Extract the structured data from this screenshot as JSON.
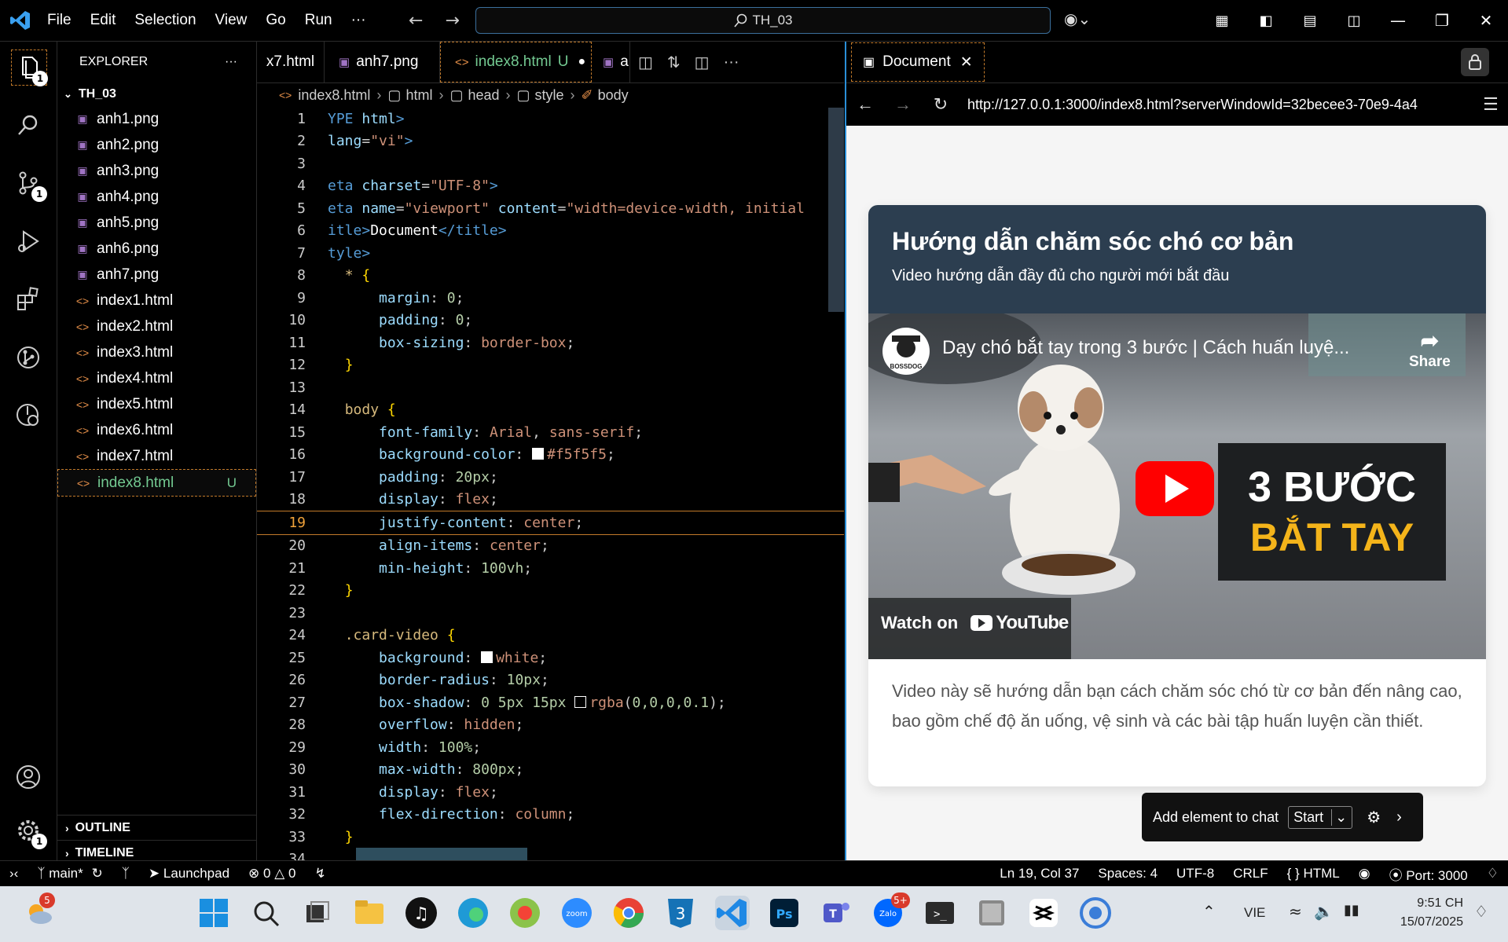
{
  "titlebar": {
    "menus": [
      "File",
      "Edit",
      "Selection",
      "View",
      "Go",
      "Run",
      "···"
    ],
    "search": "TH_03"
  },
  "activity": {
    "explorer_badge": "1",
    "scm_badge": "1",
    "settings_badge": "1"
  },
  "explorer": {
    "header": "EXPLORER",
    "folder": "TH_03",
    "files": [
      {
        "name": "anh1.png",
        "type": "png"
      },
      {
        "name": "anh2.png",
        "type": "png"
      },
      {
        "name": "anh3.png",
        "type": "png"
      },
      {
        "name": "anh4.png",
        "type": "png"
      },
      {
        "name": "anh5.png",
        "type": "png"
      },
      {
        "name": "anh6.png",
        "type": "png"
      },
      {
        "name": "anh7.png",
        "type": "png"
      },
      {
        "name": "index1.html",
        "type": "html"
      },
      {
        "name": "index2.html",
        "type": "html"
      },
      {
        "name": "index3.html",
        "type": "html"
      },
      {
        "name": "index4.html",
        "type": "html"
      },
      {
        "name": "index5.html",
        "type": "html"
      },
      {
        "name": "index6.html",
        "type": "html"
      },
      {
        "name": "index7.html",
        "type": "html"
      },
      {
        "name": "index8.html",
        "type": "html",
        "status": "U",
        "active": true
      }
    ],
    "outline": "OUTLINE",
    "timeline": "TIMELINE"
  },
  "editor": {
    "tabs": [
      {
        "label": "x7.html",
        "icon": ""
      },
      {
        "label": "anh7.png",
        "icon": "png"
      },
      {
        "label": "index8.html",
        "icon": "html",
        "status": "U",
        "active": true
      },
      {
        "label": "anh",
        "icon": "png"
      }
    ],
    "breadcrumb": [
      "index8.html",
      "html",
      "head",
      "style",
      "body"
    ],
    "current_line": 19,
    "lines": [
      [
        [
          "tk-tag",
          "YPE "
        ],
        [
          "tk-attr",
          "html"
        ],
        [
          "tk-tag",
          ">"
        ]
      ],
      [
        [
          "tk-attr",
          "lang"
        ],
        [
          "tk-p",
          "="
        ],
        [
          "tk-str",
          "\"vi\""
        ],
        [
          "tk-tag",
          ">"
        ]
      ],
      [],
      [
        [
          "tk-tag",
          "eta "
        ],
        [
          "tk-attr",
          "charset"
        ],
        [
          "tk-p",
          "="
        ],
        [
          "tk-str",
          "\"UTF-8\""
        ],
        [
          "tk-tag",
          ">"
        ]
      ],
      [
        [
          "tk-tag",
          "eta "
        ],
        [
          "tk-attr",
          "name"
        ],
        [
          "tk-p",
          "="
        ],
        [
          "tk-str",
          "\"viewport\" "
        ],
        [
          "tk-attr",
          "content"
        ],
        [
          "tk-p",
          "="
        ],
        [
          "tk-str",
          "\"width=device-width, initial"
        ]
      ],
      [
        [
          "tk-tag",
          "itle>"
        ],
        [
          "tk-txt",
          "Document"
        ],
        [
          "tk-tag",
          "</title>"
        ]
      ],
      [
        [
          "tk-tag",
          "tyle>"
        ]
      ],
      [
        [
          "tk-p",
          "  "
        ],
        [
          "tk-sel",
          "* "
        ],
        [
          "tk-br",
          "{"
        ]
      ],
      [
        [
          "tk-p",
          "      "
        ],
        [
          "tk-prop",
          "margin"
        ],
        [
          "tk-p",
          ": "
        ],
        [
          "tk-num",
          "0"
        ],
        [
          "tk-p",
          ";"
        ]
      ],
      [
        [
          "tk-p",
          "      "
        ],
        [
          "tk-prop",
          "padding"
        ],
        [
          "tk-p",
          ": "
        ],
        [
          "tk-num",
          "0"
        ],
        [
          "tk-p",
          ";"
        ]
      ],
      [
        [
          "tk-p",
          "      "
        ],
        [
          "tk-prop",
          "box-sizing"
        ],
        [
          "tk-p",
          ": "
        ],
        [
          "tk-val",
          "border-box"
        ],
        [
          "tk-p",
          ";"
        ]
      ],
      [
        [
          "tk-p",
          "  "
        ],
        [
          "tk-br",
          "}"
        ]
      ],
      [],
      [
        [
          "tk-p",
          "  "
        ],
        [
          "tk-sel",
          "body "
        ],
        [
          "tk-br",
          "{"
        ]
      ],
      [
        [
          "tk-p",
          "      "
        ],
        [
          "tk-prop",
          "font-family"
        ],
        [
          "tk-p",
          ": "
        ],
        [
          "tk-val",
          "Arial"
        ],
        [
          "tk-p",
          ", "
        ],
        [
          "tk-val",
          "sans-serif"
        ],
        [
          "tk-p",
          ";"
        ]
      ],
      [
        [
          "tk-p",
          "      "
        ],
        [
          "tk-prop",
          "background-color"
        ],
        [
          "tk-p",
          ": "
        ],
        [
          "swatch",
          "#ffffff"
        ],
        [
          "tk-val",
          "#f5f5f5"
        ],
        [
          "tk-p",
          ";"
        ]
      ],
      [
        [
          "tk-p",
          "      "
        ],
        [
          "tk-prop",
          "padding"
        ],
        [
          "tk-p",
          ": "
        ],
        [
          "tk-num",
          "20px"
        ],
        [
          "tk-p",
          ";"
        ]
      ],
      [
        [
          "tk-p",
          "      "
        ],
        [
          "tk-prop",
          "display"
        ],
        [
          "tk-p",
          ": "
        ],
        [
          "tk-val",
          "flex"
        ],
        [
          "tk-p",
          ";"
        ]
      ],
      [
        [
          "tk-p",
          "      "
        ],
        [
          "tk-prop",
          "justify-content"
        ],
        [
          "tk-p",
          ": "
        ],
        [
          "tk-val",
          "center"
        ],
        [
          "tk-p",
          ";"
        ]
      ],
      [
        [
          "tk-p",
          "      "
        ],
        [
          "tk-prop",
          "align-items"
        ],
        [
          "tk-p",
          ": "
        ],
        [
          "tk-val",
          "center"
        ],
        [
          "tk-p",
          ";"
        ]
      ],
      [
        [
          "tk-p",
          "      "
        ],
        [
          "tk-prop",
          "min-height"
        ],
        [
          "tk-p",
          ": "
        ],
        [
          "tk-num",
          "100vh"
        ],
        [
          "tk-p",
          ";"
        ]
      ],
      [
        [
          "tk-p",
          "  "
        ],
        [
          "tk-br",
          "}"
        ]
      ],
      [],
      [
        [
          "tk-p",
          "  "
        ],
        [
          "tk-sel",
          ".card-video "
        ],
        [
          "tk-br",
          "{"
        ]
      ],
      [
        [
          "tk-p",
          "      "
        ],
        [
          "tk-prop",
          "background"
        ],
        [
          "tk-p",
          ": "
        ],
        [
          "swatch",
          "#ffffff"
        ],
        [
          "tk-val",
          "white"
        ],
        [
          "tk-p",
          ";"
        ]
      ],
      [
        [
          "tk-p",
          "      "
        ],
        [
          "tk-prop",
          "border-radius"
        ],
        [
          "tk-p",
          ": "
        ],
        [
          "tk-num",
          "10px"
        ],
        [
          "tk-p",
          ";"
        ]
      ],
      [
        [
          "tk-p",
          "      "
        ],
        [
          "tk-prop",
          "box-shadow"
        ],
        [
          "tk-p",
          ": "
        ],
        [
          "tk-num",
          "0 5px 15px "
        ],
        [
          "swatch",
          "#000000"
        ],
        [
          "tk-val",
          "rgba"
        ],
        [
          "tk-p",
          "("
        ],
        [
          "tk-num",
          "0,0,0,0.1"
        ],
        [
          "tk-p",
          ");"
        ]
      ],
      [
        [
          "tk-p",
          "      "
        ],
        [
          "tk-prop",
          "overflow"
        ],
        [
          "tk-p",
          ": "
        ],
        [
          "tk-val",
          "hidden"
        ],
        [
          "tk-p",
          ";"
        ]
      ],
      [
        [
          "tk-p",
          "      "
        ],
        [
          "tk-prop",
          "width"
        ],
        [
          "tk-p",
          ": "
        ],
        [
          "tk-num",
          "100%"
        ],
        [
          "tk-p",
          ";"
        ]
      ],
      [
        [
          "tk-p",
          "      "
        ],
        [
          "tk-prop",
          "max-width"
        ],
        [
          "tk-p",
          ": "
        ],
        [
          "tk-num",
          "800px"
        ],
        [
          "tk-p",
          ";"
        ]
      ],
      [
        [
          "tk-p",
          "      "
        ],
        [
          "tk-prop",
          "display"
        ],
        [
          "tk-p",
          ": "
        ],
        [
          "tk-val",
          "flex"
        ],
        [
          "tk-p",
          ";"
        ]
      ],
      [
        [
          "tk-p",
          "      "
        ],
        [
          "tk-prop",
          "flex-direction"
        ],
        [
          "tk-p",
          ": "
        ],
        [
          "tk-val",
          "column"
        ],
        [
          "tk-p",
          ";"
        ]
      ],
      [
        [
          "tk-p",
          "  "
        ],
        [
          "tk-br",
          "}"
        ]
      ],
      []
    ]
  },
  "preview": {
    "tab_title": "Document",
    "url": "http://127.0.0.1:3000/index8.html?serverWindowId=32becee3-70e9-4a4",
    "card_title": "Hướng dẫn chăm sóc chó cơ bản",
    "card_subtitle": "Video hướng dẫn đầy đủ cho người mới bắt đầu",
    "video": {
      "title": "Dạy chó bắt tay trong 3 bước | Cách huấn luyệ...",
      "channel_logo_text": "BOSSDOG",
      "share": "Share",
      "overlay_line1": "3 BƯỚC",
      "overlay_line2": "BẮT TAY",
      "watch_on": "Watch on",
      "youtube": "YouTube"
    },
    "description": "Video này sẽ hướng dẫn bạn cách chăm sóc chó từ cơ bản đến nâng cao, bao gồm chế độ ăn uống, vệ sinh và các bài tập huấn luyện cần thiết.",
    "chat_label": "Add element to chat",
    "chat_start": "Start"
  },
  "statusbar": {
    "branch": "main*",
    "launchpad": "Launchpad",
    "errors": "0",
    "warnings": "0",
    "position": "Ln 19, Col 37",
    "spaces": "Spaces: 4",
    "encoding": "UTF-8",
    "eol": "CRLF",
    "language": "HTML",
    "port": "Port: 3000"
  },
  "taskbar": {
    "weather_badge": "5",
    "zalo_badge": "5+",
    "language": "VIE",
    "time": "9:51 CH",
    "date": "15/07/2025"
  },
  "colors": {
    "accent": "#2a8fd8",
    "modified": "#73c991",
    "card_header": "#2c3e50",
    "youtube_red": "#ff0000",
    "overlay_yellow": "#f4b41a"
  }
}
